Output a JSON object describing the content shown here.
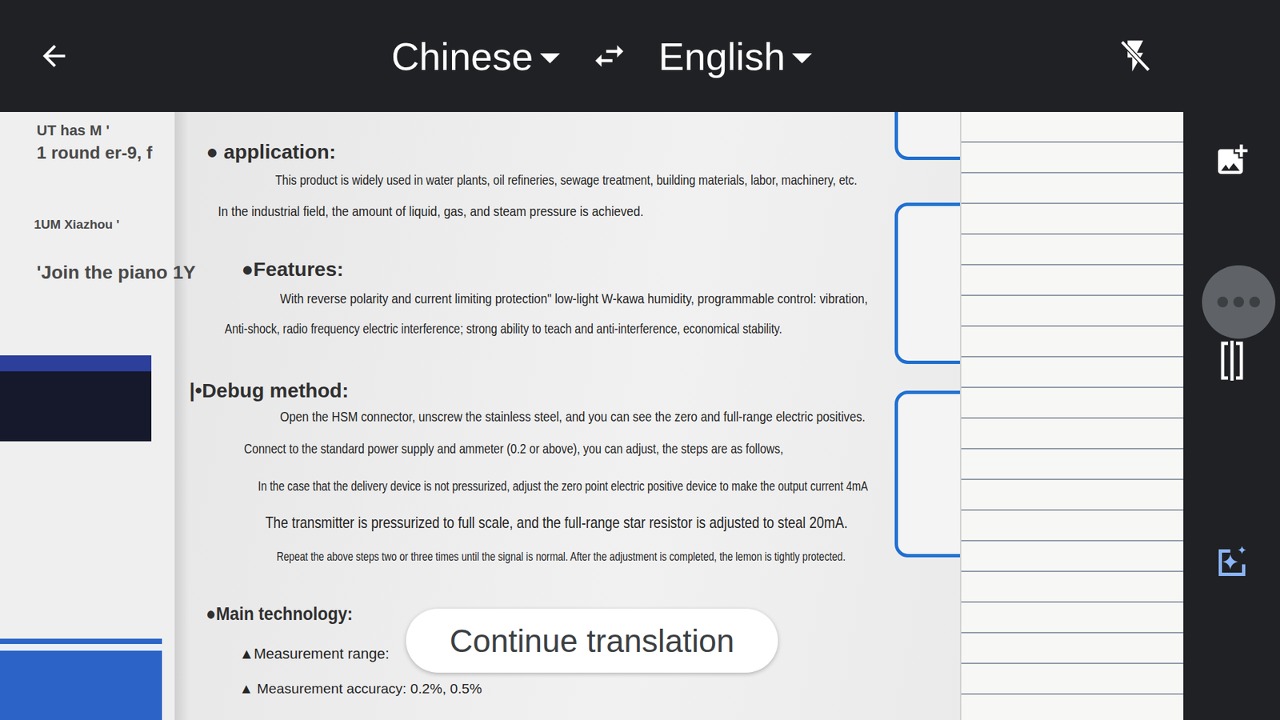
{
  "top_bar": {
    "source_language": "Chinese",
    "target_language": "English",
    "flash_on": false
  },
  "translation": {
    "lines": [
      {
        "text": "UT has M '",
        "kind": "fragment"
      },
      {
        "text": "1 round er-9, f",
        "kind": "fragment"
      },
      {
        "text": "● application:",
        "kind": "heading"
      },
      {
        "text": "This product is widely used in water plants, oil refineries, sewage treatment, building materials, labor, machinery, etc.",
        "kind": "body"
      },
      {
        "text": "In the industrial field, the amount of liquid, gas, and steam pressure is achieved.",
        "kind": "body"
      },
      {
        "text": "1UM Xiazhou '",
        "kind": "fragment"
      },
      {
        "text": "'Join the piano 1Y",
        "kind": "fragment"
      },
      {
        "text": "●Features:",
        "kind": "heading"
      },
      {
        "text": "With reverse polarity and current limiting protection\" low-light W-kawa humidity, programmable control: vibration,",
        "kind": "body"
      },
      {
        "text": "Anti-shock, radio frequency electric interference; strong ability to teach and anti-interference, economical stability.",
        "kind": "body"
      },
      {
        "text": "|•Debug method:",
        "kind": "heading"
      },
      {
        "text": "Open the HSM connector, unscrew the stainless steel, and you can see the zero and full-range electric positives.",
        "kind": "body"
      },
      {
        "text": "Connect to the standard power supply and ammeter (0.2 or above), you can adjust, the steps are as follows,",
        "kind": "body"
      },
      {
        "text": "In the case that the delivery device is not pressurized, adjust the zero point electric positive device to make the output current 4mA",
        "kind": "body"
      },
      {
        "text": "The transmitter is pressurized to full scale, and the full-range star resistor is adjusted to steal 20mA.",
        "kind": "body"
      },
      {
        "text": "Repeat the above steps two or three times until the signal is normal. After the adjustment is completed, the lemon is tightly protected.",
        "kind": "body"
      },
      {
        "text": "●Main technology:",
        "kind": "heading"
      },
      {
        "text": "▲Measurement range:",
        "kind": "body"
      },
      {
        "text": "▲ Measurement accuracy: 0.2%, 0.5%",
        "kind": "body"
      }
    ]
  },
  "continue_button": {
    "label": "Continue translation"
  }
}
